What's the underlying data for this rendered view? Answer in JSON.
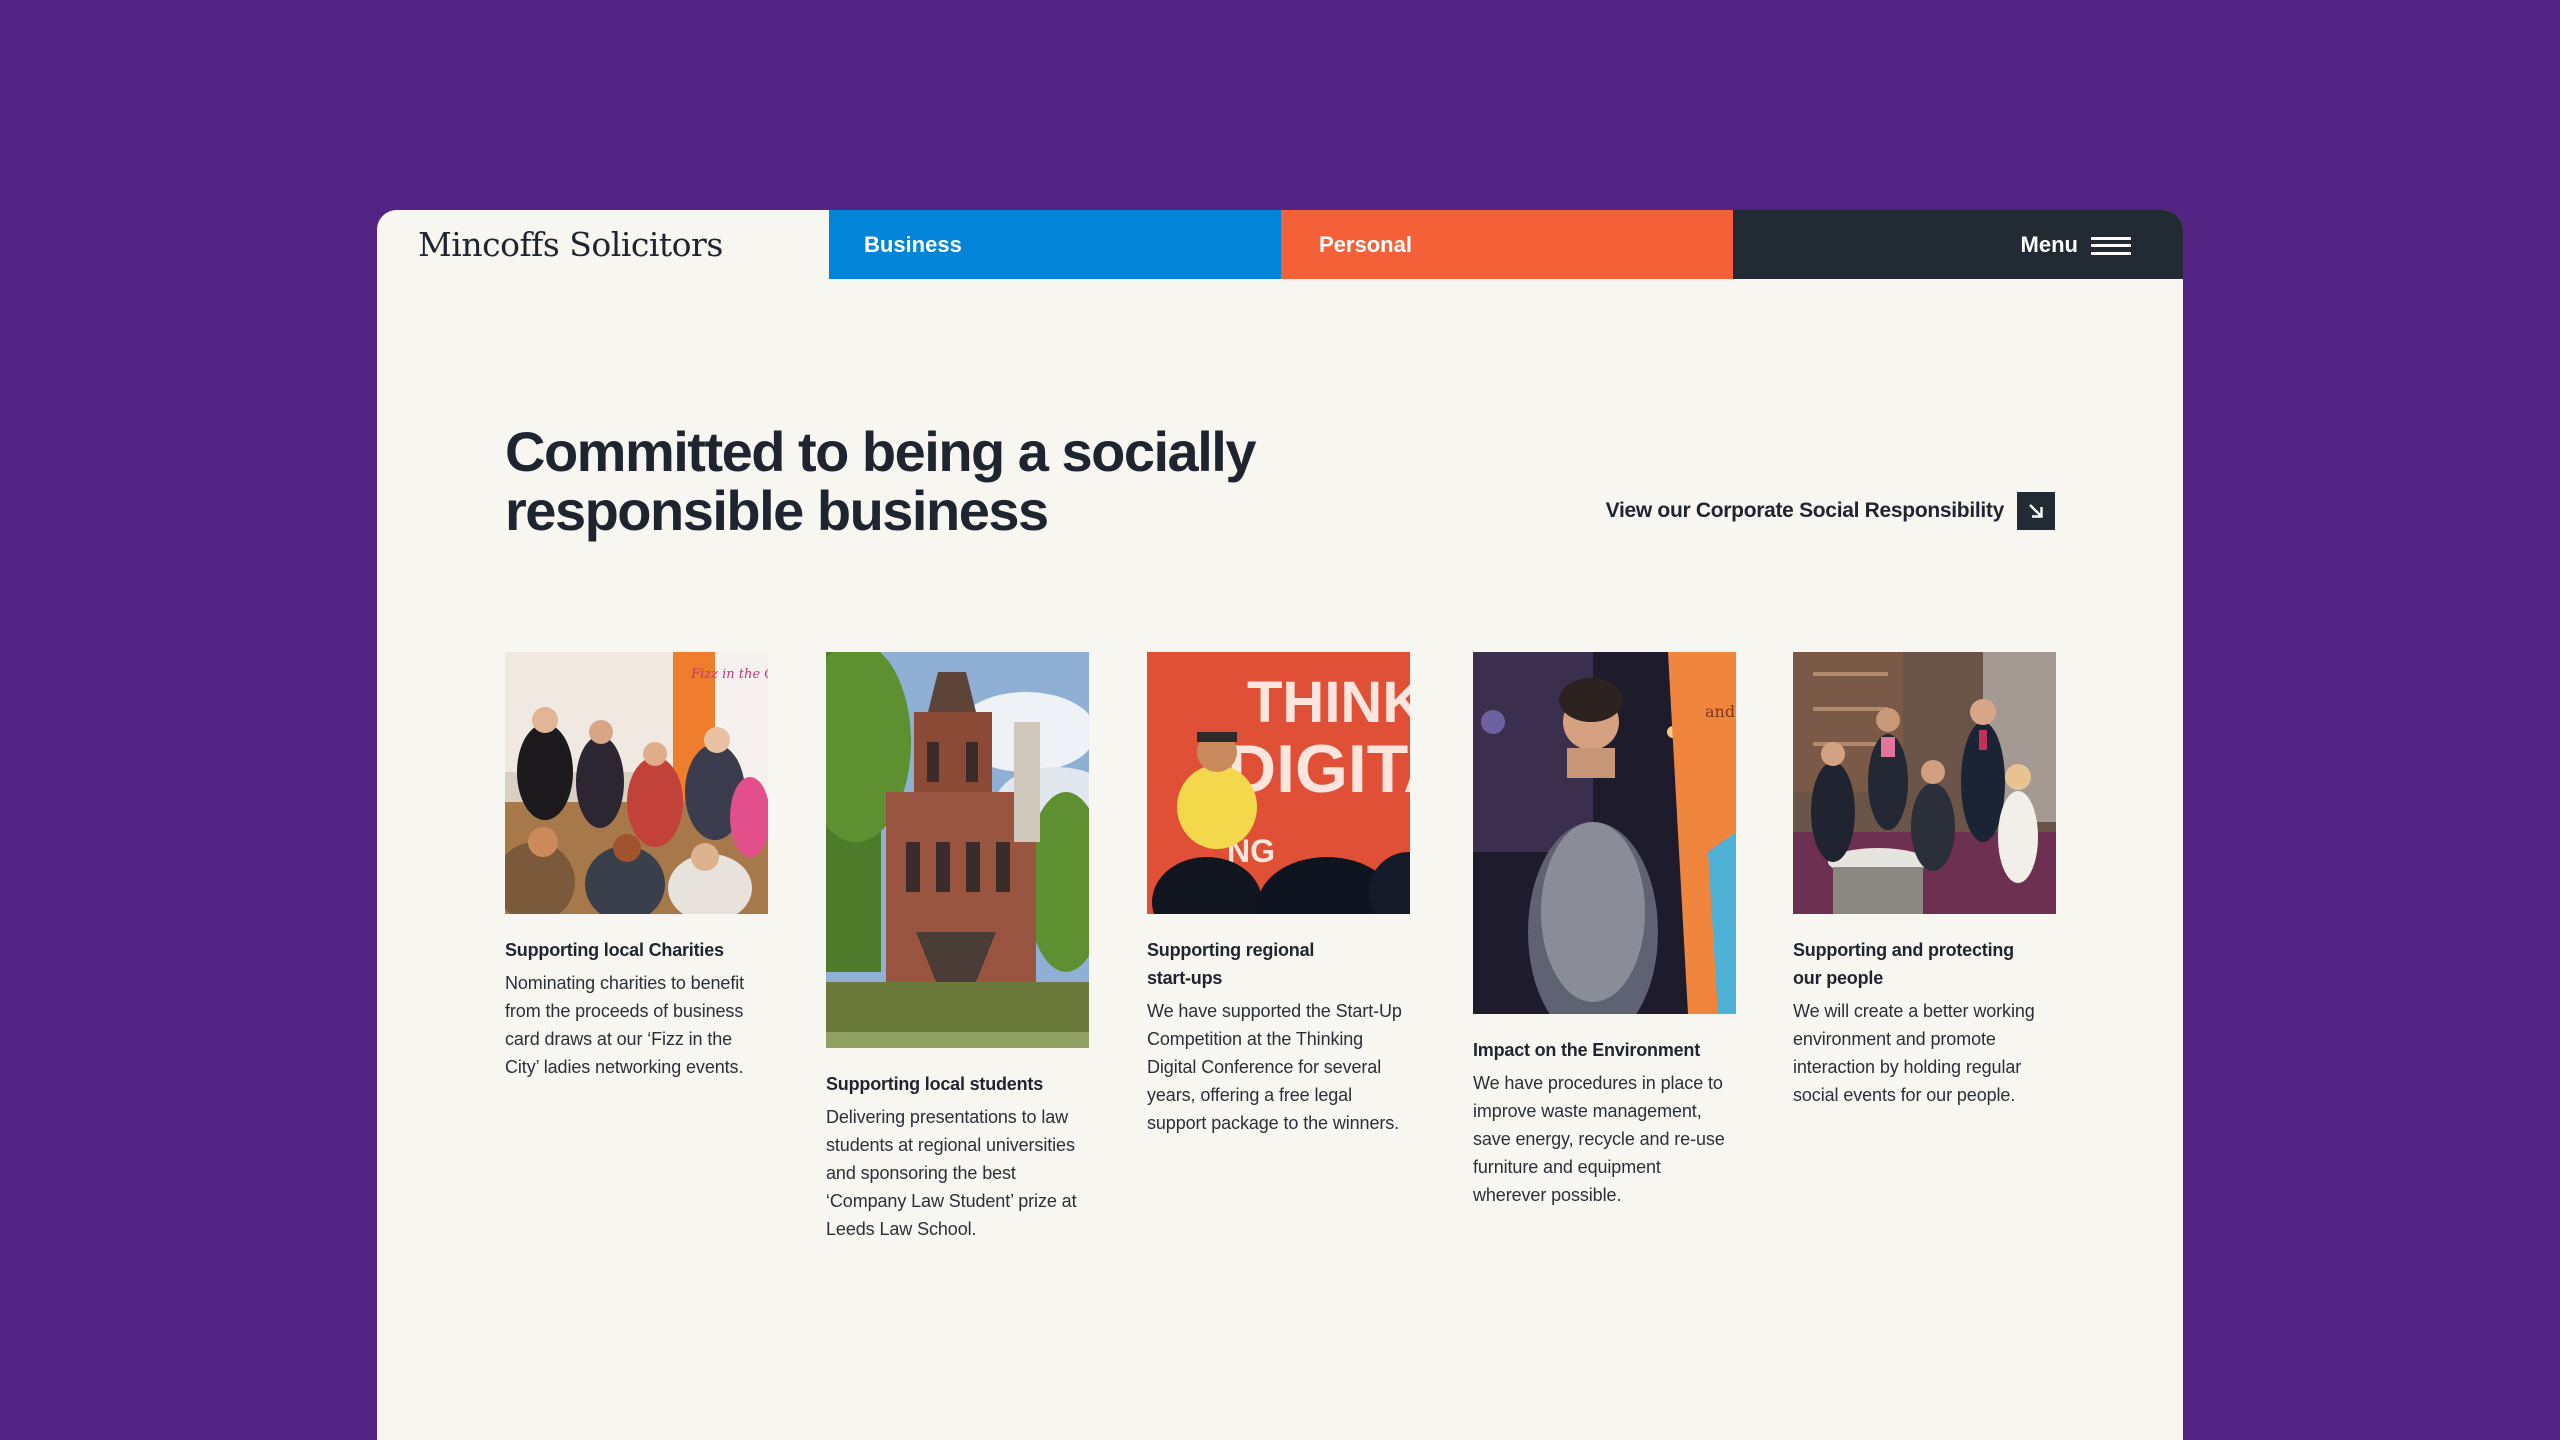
{
  "nav": {
    "brand": "Mincoffs Solicitors",
    "business_label": "Business",
    "personal_label": "Personal",
    "menu_label": "Menu"
  },
  "hero": {
    "title_line1": "Committed to being a socially",
    "title_line2": "responsible business",
    "csr_link_label": "View our Corporate Social Responsibility"
  },
  "cards": [
    {
      "title": "Supporting local Charities",
      "body": "Nominating charities to benefit from the proceeds of business card draws at our ‘Fizz in the City’ ladies networking events.",
      "image_banner": "Fizz in the City"
    },
    {
      "title": "Supporting local students",
      "body": "Delivering presentations to law students at regional universities and sponsoring the best ‘Company Law Student’ prize at Leeds Law School."
    },
    {
      "title_line1": "Supporting regional",
      "title_line2": "start-ups",
      "body": "We have supported the Start-Up Competition at the Thinking Digital Conference for several years, offering a free legal support package to the winners.",
      "image_banner_line1": "THINKIN",
      "image_banner_line2": "DIGITA",
      "image_banner_line3": "NG",
      "image_banner_line4": "AL"
    },
    {
      "title": "Impact on the Environment",
      "body": "We have procedures in place to improve waste management, save energy, recycle and re-use furniture and equipment wherever possible.",
      "image_banner": "and"
    },
    {
      "title_line1": "Supporting and protecting",
      "title_line2": "our people",
      "body": "We will create a better working environment and promote interaction by holding regular social events for our people."
    }
  ],
  "colors": {
    "background": "#532483",
    "business": "#0284d8",
    "personal": "#f46138",
    "menu": "#222a33",
    "page": "#f7f6f0",
    "text": "#1f2530"
  },
  "icons": {
    "menu": "hamburger-icon",
    "csr_link": "arrow-down-right-icon"
  }
}
